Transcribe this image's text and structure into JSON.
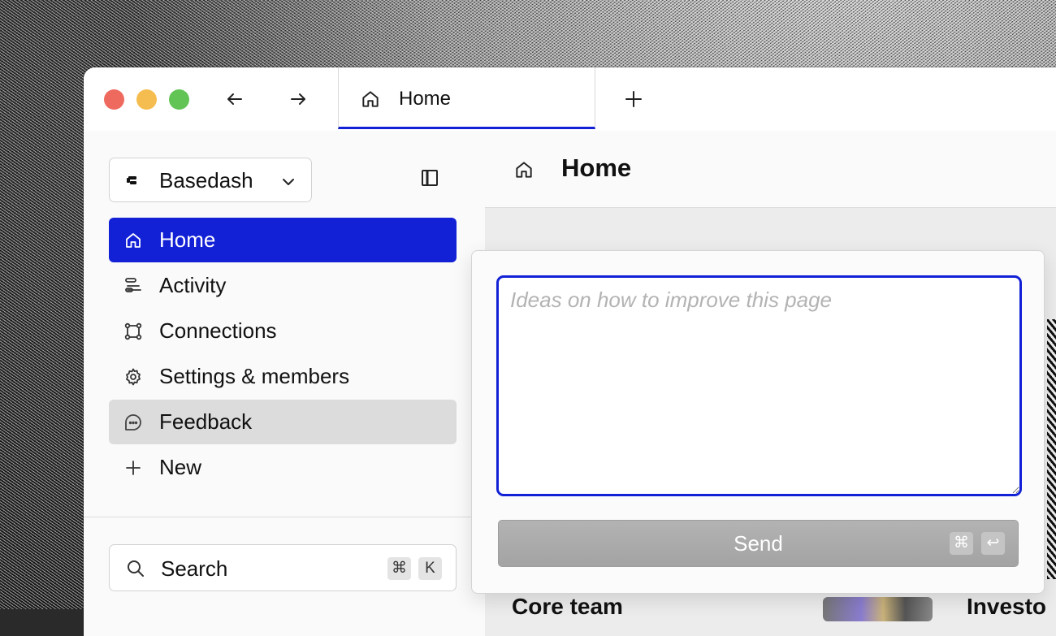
{
  "titlebar": {
    "tab_label": "Home",
    "new_tab_symbol": "+"
  },
  "sidebar": {
    "workspace_name": "Basedash",
    "items": [
      {
        "label": "Home",
        "icon": "home-icon"
      },
      {
        "label": "Activity",
        "icon": "activity-icon"
      },
      {
        "label": "Connections",
        "icon": "connections-icon"
      },
      {
        "label": "Settings & members",
        "icon": "gear-icon"
      },
      {
        "label": "Feedback",
        "icon": "chat-bubble-icon"
      },
      {
        "label": "New",
        "icon": "plus-icon"
      }
    ],
    "search": {
      "label": "Search",
      "shortcut_mod": "⌘",
      "shortcut_key": "K"
    }
  },
  "main": {
    "title": "Home",
    "background_headings": [
      "Core team",
      "Investo"
    ]
  },
  "feedback": {
    "placeholder": "Ideas on how to improve this page",
    "value": "",
    "send_label": "Send",
    "send_shortcut_mod": "⌘",
    "send_shortcut_key": "↩"
  },
  "colors": {
    "accent": "#1220d6",
    "hover": "#dcdcdc",
    "send_disabled": "#a8a8a8"
  }
}
